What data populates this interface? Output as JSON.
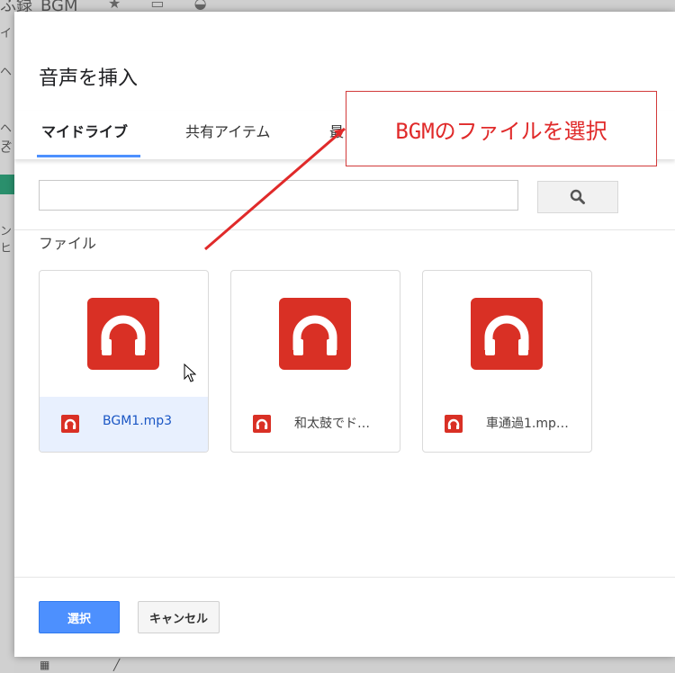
{
  "background": {
    "title_fragment": "ふ録_BGM",
    "toolbar_icons": [
      "star-icon",
      "folder-icon",
      "cloud-icon"
    ],
    "left_fragments": [
      "イ",
      "ヘ",
      "ヘス",
      "ご",
      "ンヒ"
    ]
  },
  "dialog": {
    "title": "音声を挿入",
    "tabs": [
      {
        "label": "マイドライブ",
        "active": true
      },
      {
        "label": "共有アイテム",
        "active": false
      },
      {
        "label": "最",
        "active": false
      }
    ],
    "search": {
      "value": "",
      "placeholder": ""
    },
    "section_label": "ファイル",
    "files": [
      {
        "name": "BGM1.mp3",
        "icon": "headphones-icon",
        "selected": true
      },
      {
        "name": "和太鼓でド…",
        "icon": "headphones-icon",
        "selected": false
      },
      {
        "name": "車通過1.mp…",
        "icon": "headphones-icon",
        "selected": false
      }
    ],
    "buttons": {
      "select": "選択",
      "cancel": "キャンセル"
    }
  },
  "annotation": {
    "text": "BGMのファイルを選択",
    "color": "#e02a2a"
  },
  "colors": {
    "accent": "#4d90fe",
    "audio_icon": "#d93025",
    "selected_bg": "#e8f0fe"
  }
}
